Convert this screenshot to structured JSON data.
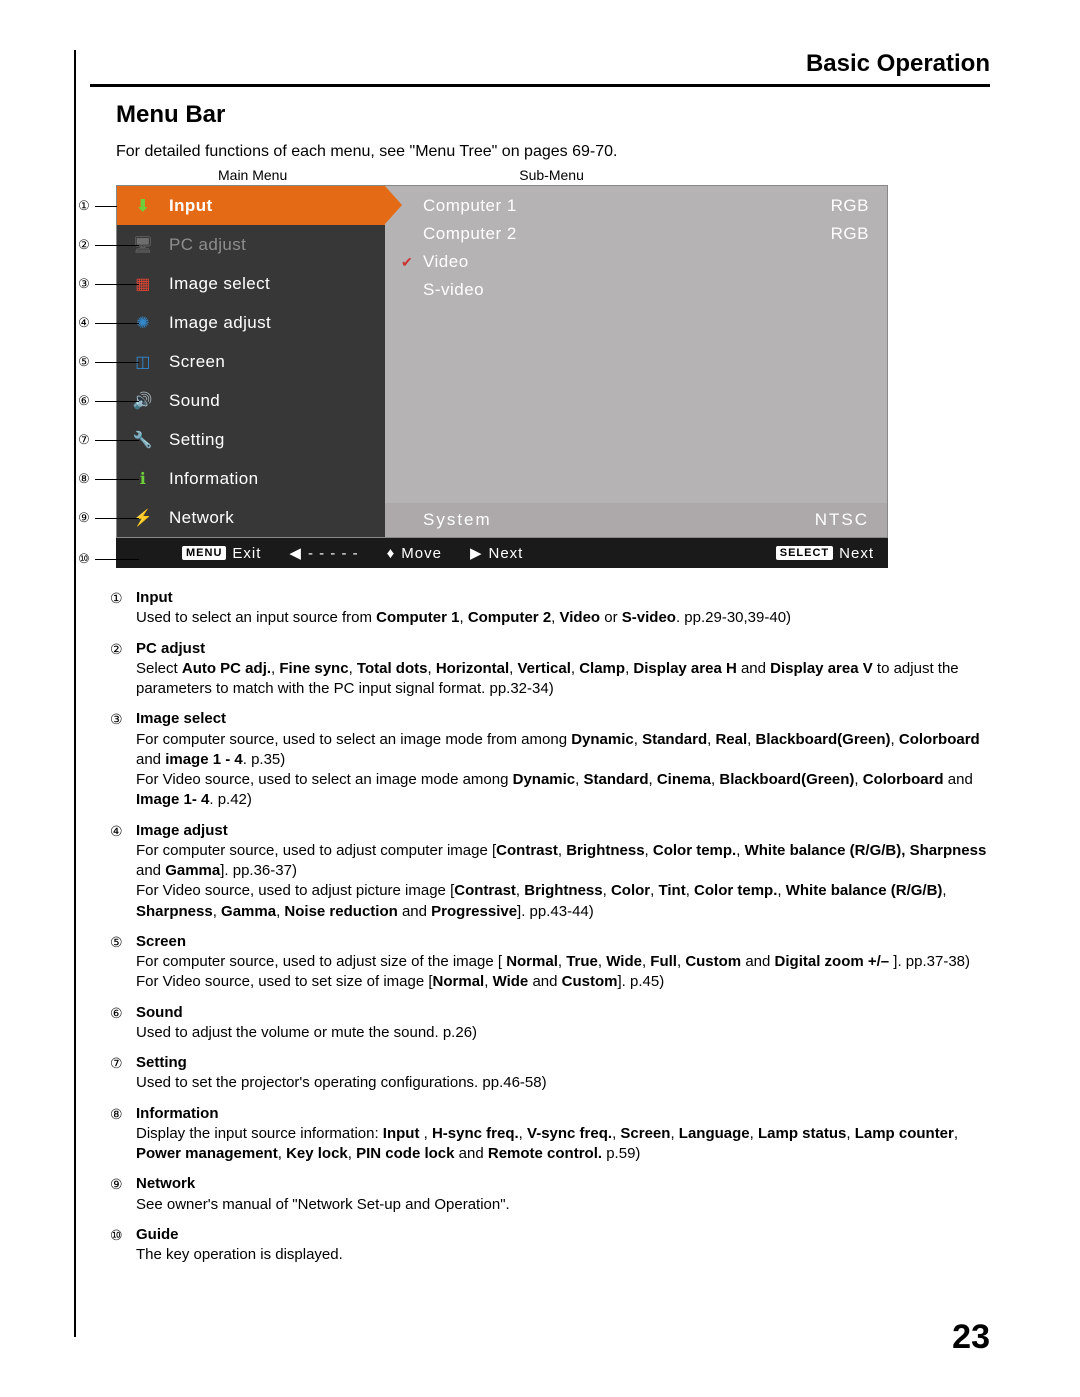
{
  "header": {
    "section": "Basic Operation"
  },
  "title": "Menu Bar",
  "intro": "For detailed functions of each menu, see \"Menu Tree\" on pages 69-70.",
  "fig": {
    "main_label": "Main Menu",
    "sub_label": "Sub-Menu",
    "main_items": [
      {
        "label": "Input",
        "state": "active",
        "icon": "input"
      },
      {
        "label": "PC adjust",
        "state": "dim",
        "icon": "pc"
      },
      {
        "label": "Image select",
        "state": "",
        "icon": "imgsel"
      },
      {
        "label": "Image adjust",
        "state": "",
        "icon": "imgadj"
      },
      {
        "label": "Screen",
        "state": "",
        "icon": "screen"
      },
      {
        "label": "Sound",
        "state": "",
        "icon": "sound"
      },
      {
        "label": "Setting",
        "state": "",
        "icon": "setting"
      },
      {
        "label": "Information",
        "state": "",
        "icon": "info"
      },
      {
        "label": "Network",
        "state": "",
        "icon": "net"
      }
    ],
    "sub_left": [
      {
        "label": "Computer 1",
        "checked": false
      },
      {
        "label": "Computer 2",
        "checked": false
      },
      {
        "label": "Video",
        "checked": true
      },
      {
        "label": "S-video",
        "checked": false
      }
    ],
    "sub_right": [
      "RGB",
      "RGB"
    ],
    "system": {
      "label": "System",
      "value": "NTSC"
    },
    "guide": {
      "exit_btn": "MENU",
      "exit": "Exit",
      "back": "- - - - -",
      "move": "Move",
      "next": "Next",
      "select_btn": "SELECT",
      "select_next": "Next"
    },
    "numbers": [
      "①",
      "②",
      "③",
      "④",
      "⑤",
      "⑥",
      "⑦",
      "⑧",
      "⑨",
      "⑩"
    ]
  },
  "desc": [
    {
      "num": "①",
      "title": "Input",
      "body_html": "Used to select an input source from <b>Computer 1</b>, <b>Computer 2</b>, <b>Video</b> or <b>S-video</b>.  pp.29-30,39-40)"
    },
    {
      "num": "②",
      "title": "PC adjust",
      "body_html": "Select <b>Auto PC adj.</b>, <b>Fine sync</b>, <b>Total dots</b>, <b>Horizontal</b>, <b>Vertical</b>, <b>Clamp</b>, <b>Display area H</b> and <b>Display area V</b> to adjust the parameters to match with the PC input signal format.  pp.32-34)"
    },
    {
      "num": "③",
      "title": "Image select",
      "body_html": "For computer source, used to select an image mode from among <b>Dynamic</b>, <b>Standard</b>, <b>Real</b>, <b>Blackboard(Green)</b>, <b>Colorboard</b> and <b>image 1 - 4</b>.  p.35)<br>For Video source, used to select an image mode among <b>Dynamic</b>, <b>Standard</b>, <b>Cinema</b>, <b>Blackboard(Green)</b>, <b>Colorboard</b> and <b>Image 1- 4</b>.  p.42)"
    },
    {
      "num": "④",
      "title": "Image adjust",
      "body_html": "For computer source, used to adjust computer image [<b>Contrast</b>, <b>Brightness</b>, <b>Color temp.</b>, <b>White balance (R/G/B), Sharpness</b> and <b>Gamma</b>].  pp.36-37)<br>For Video source, used to adjust picture image [<b>Contrast</b>, <b>Brightness</b>, <b>Color</b>, <b>Tint</b>, <b>Color temp.</b>, <b>White balance (R/G/B)</b>, <b>Sharpness</b>, <b>Gamma</b>, <b>Noise reduction</b> and <b>Progressive</b>].  pp.43-44)"
    },
    {
      "num": "⑤",
      "title": "Screen",
      "body_html": "For computer source, used to adjust size of the image [ <b>Normal</b>, <b>True</b>, <b>Wide</b>, <b>Full</b>, <b>Custom</b> and <b>Digital zoom +/–</b> ].  pp.37-38)<br>For Video source, used to set size  of image [<b>Normal</b>, <b>Wide</b> and <b>Custom</b>].  p.45)"
    },
    {
      "num": "⑥",
      "title": "Sound",
      "body_html": "Used to adjust the volume or mute the sound.  p.26)"
    },
    {
      "num": "⑦",
      "title": "Setting",
      "body_html": "Used to set the projector's operating configurations.  pp.46-58)"
    },
    {
      "num": "⑧",
      "title": "Information",
      "body_html": "Display the input source information: <b>Input</b> , <b>H-sync freq.</b>, <b>V-sync freq.</b>, <b>Screen</b>, <b>Language</b>, <b>Lamp status</b>, <b>Lamp counter</b>, <b>Power management</b>, <b>Key lock</b>, <b>PIN code lock</b> and <b>Remote control.</b>  p.59)"
    },
    {
      "num": "⑨",
      "title": "Network",
      "body_html": "See owner's manual of \"Network Set-up and Operation\"."
    },
    {
      "num": "⑩",
      "title": "Guide",
      "body_html": "The key operation is displayed."
    }
  ],
  "page_number": "23"
}
